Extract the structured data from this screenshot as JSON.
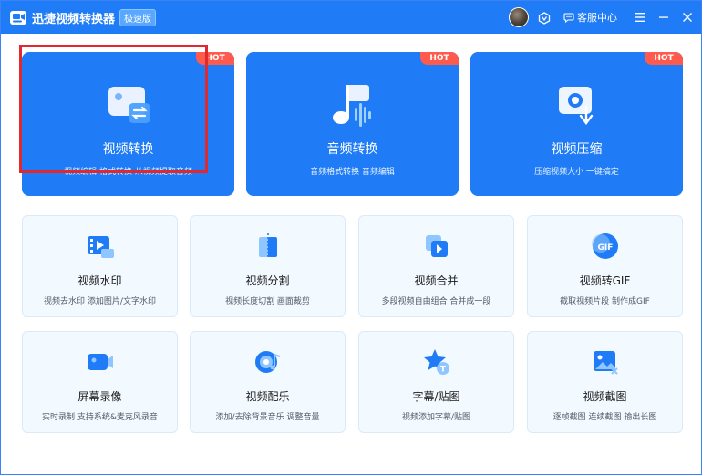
{
  "titlebar": {
    "app_name": "迅捷视频转换器",
    "edition": "极速版",
    "service_label": "客服中心"
  },
  "featured": [
    {
      "title": "视频转换",
      "subtitle": "视频编辑 格式转换 从视频提取音频",
      "badge": "HOT"
    },
    {
      "title": "音频转换",
      "subtitle": "音频格式转换 音频编辑",
      "badge": "HOT"
    },
    {
      "title": "视频压缩",
      "subtitle": "压缩视频大小 一键搞定",
      "badge": "HOT"
    }
  ],
  "tools": [
    {
      "title": "视频水印",
      "subtitle": "视频去水印 添加图片/文字水印",
      "icon": "video-watermark-icon"
    },
    {
      "title": "视频分割",
      "subtitle": "视频长度切割 画面裁剪",
      "icon": "video-split-icon"
    },
    {
      "title": "视频合并",
      "subtitle": "多段视频自由组合 合并成一段",
      "icon": "video-merge-icon"
    },
    {
      "title": "视频转GIF",
      "subtitle": "截取视频片段 制作成GIF",
      "icon": "gif-icon"
    },
    {
      "title": "屏幕录像",
      "subtitle": "实时录制 支持系统&麦克风录音",
      "icon": "camera-icon"
    },
    {
      "title": "视频配乐",
      "subtitle": "添加/去除背景音乐 调整音量",
      "icon": "music-disc-icon"
    },
    {
      "title": "字幕/贴图",
      "subtitle": "视频添加字幕/贴图",
      "icon": "star-text-icon"
    },
    {
      "title": "视频截图",
      "subtitle": "逐帧截图 连续截图 输出长图",
      "icon": "image-screenshot-icon"
    }
  ],
  "colors": {
    "titlebar": "#1f7cf6",
    "card_blue": "#1f7cf6",
    "hot_badge": "#ff5a4e",
    "highlight": "#e0282e",
    "tool_card_bg": "#f2f9ff"
  }
}
